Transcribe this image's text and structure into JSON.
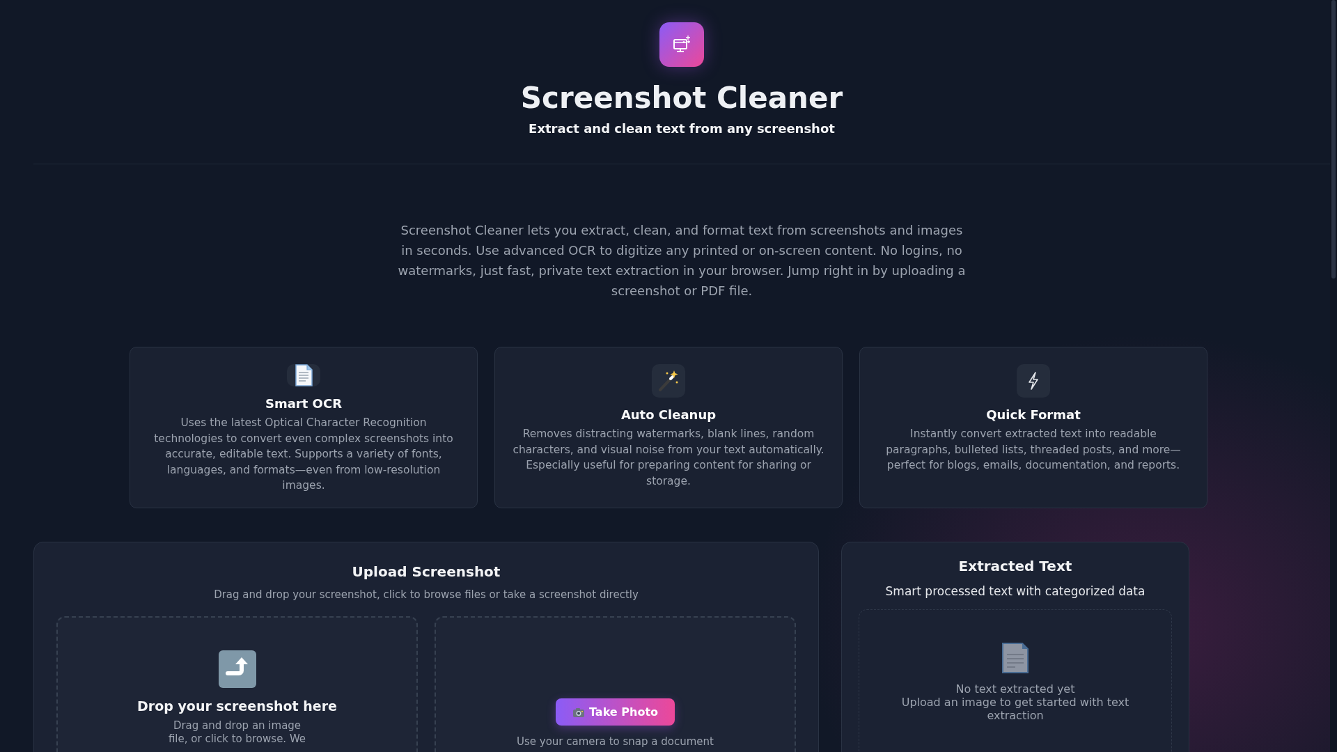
{
  "header": {
    "title": "Screenshot Cleaner",
    "subtitle": "Extract and clean text from any screenshot"
  },
  "intro": "Screenshot Cleaner lets you extract, clean, and format text from screenshots and images in seconds. Use advanced OCR to digitize any printed or on-screen content. No logins, no watermarks, just fast, private text extraction in your browser. Jump right in by uploading a screenshot or PDF file.",
  "features": [
    {
      "kind": "document",
      "title": "Smart OCR",
      "description": "Uses the latest Optical Character Recognition technologies to convert even complex screenshots into accurate, editable text. Supports a variety of fonts, languages, and formats—even from low-resolution images."
    },
    {
      "kind": "wand",
      "title": "Auto Cleanup",
      "description": "Removes distracting watermarks, blank lines, random characters, and visual noise from your text automatically. Especially useful for preparing content for sharing or storage."
    },
    {
      "kind": "bolt",
      "title": "Quick Format",
      "description": "Instantly convert extracted text into readable paragraphs, bulleted lists, threaded posts, and more—perfect for blogs, emails, documentation, and reports."
    }
  ],
  "upload": {
    "title": "Upload Screenshot",
    "subtitle": "Drag and drop your screenshot, click to browse files or take a screenshot directly",
    "dropzone": {
      "title": "Drop your screenshot here",
      "lines": [
        "Drag and drop an image",
        "file, or click to browse. We"
      ]
    },
    "camera": {
      "button": "Take Photo",
      "hint": "Use your camera to snap a document"
    }
  },
  "extracted": {
    "title": "Extracted Text",
    "subtitle": "Smart processed text with categorized data",
    "empty_title": "No text extracted yet",
    "empty_hint": "Upload an image to get started with text extraction"
  }
}
